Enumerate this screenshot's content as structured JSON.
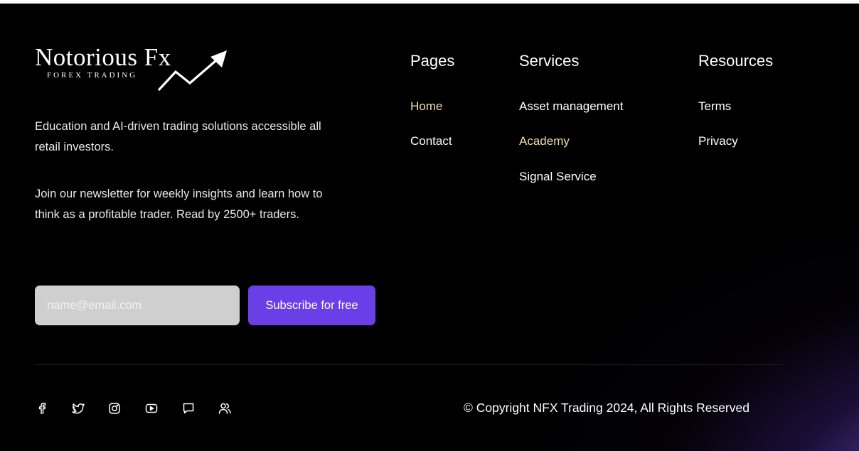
{
  "brand": {
    "name": "Notorious Fx",
    "tagline": "FOREX TRADING"
  },
  "about": {
    "description": "Education and AI-driven trading solutions accessible all retail investors.",
    "newsletter_text": "Join our newsletter for weekly insights and learn how to think as a profitable trader. Read by 2500+ traders."
  },
  "newsletter": {
    "email_placeholder": "name@email.com",
    "email_value": "",
    "subscribe_label": "Subscribe for free"
  },
  "pages": {
    "title": "Pages",
    "links": [
      {
        "label": "Home",
        "active": true
      },
      {
        "label": "Contact",
        "active": false
      }
    ]
  },
  "services": {
    "title": "Services",
    "links": [
      {
        "label": "Asset management",
        "active": false
      },
      {
        "label": "Academy",
        "active": true
      },
      {
        "label": "Signal Service",
        "active": false
      }
    ]
  },
  "resources": {
    "title": "Resources",
    "links": [
      {
        "label": "Terms",
        "active": false
      },
      {
        "label": "Privacy",
        "active": false
      }
    ]
  },
  "social": [
    "facebook-icon",
    "twitter-icon",
    "instagram-icon",
    "youtube-icon",
    "chat-icon",
    "community-icon"
  ],
  "copyright": "© Copyright NFX Trading 2024, All Rights Reserved",
  "colors": {
    "background": "#000000",
    "accent": "#6a3fe8",
    "active_link": "#f0dcae",
    "input_bg": "#cfcfcf",
    "glow": "#9673e6"
  }
}
